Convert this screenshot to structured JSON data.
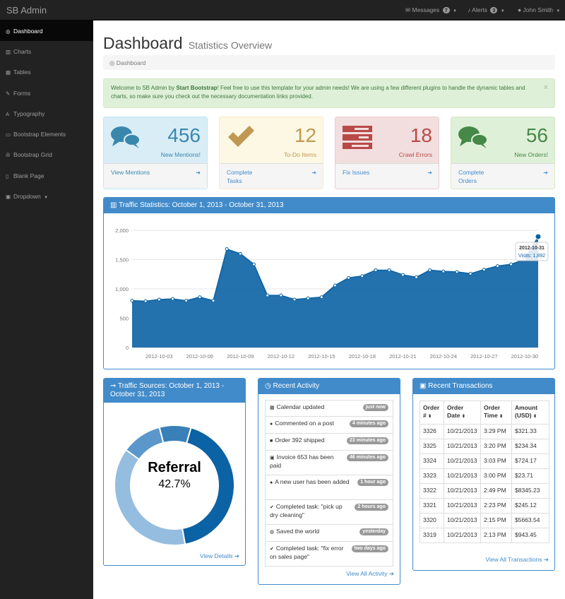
{
  "topnav": {
    "brand": "SB Admin",
    "messages": {
      "label": "Messages",
      "count": "7"
    },
    "alerts": {
      "label": "Alerts",
      "count": "3"
    },
    "user": "John Smith"
  },
  "sidebar": {
    "items": [
      {
        "label": "Dashboard",
        "icon": "dashboard-icon",
        "glyph": "◎"
      },
      {
        "label": "Charts",
        "icon": "bar-chart-icon",
        "glyph": "▥"
      },
      {
        "label": "Tables",
        "icon": "table-icon",
        "glyph": "▦"
      },
      {
        "label": "Forms",
        "icon": "edit-icon",
        "glyph": "✎"
      },
      {
        "label": "Typography",
        "icon": "font-icon",
        "glyph": "A"
      },
      {
        "label": "Bootstrap Elements",
        "icon": "desktop-icon",
        "glyph": "▭"
      },
      {
        "label": "Bootstrap Grid",
        "icon": "wrench-icon",
        "glyph": "✇"
      },
      {
        "label": "Blank Page",
        "icon": "file-icon",
        "glyph": "▯"
      },
      {
        "label": "Dropdown",
        "icon": "caret-square-icon",
        "glyph": "▣"
      }
    ]
  },
  "page": {
    "title": "Dashboard",
    "subtitle": "Statistics Overview",
    "breadcrumb": "Dashboard"
  },
  "alert": {
    "pre": "Welcome to SB Admin by ",
    "strong": "Start Bootstrap",
    "post": "! Feel free to use this template for your admin needs! We are using a few different plugins to handle the dynamic tables and charts, so make sure you check out the necessary documentation links provided.",
    "close": "×"
  },
  "stats": [
    {
      "value": "456",
      "label": "New Mentions!",
      "link": "View Mentions",
      "icon": "comments-icon",
      "color": "#3a87ad"
    },
    {
      "value": "12",
      "label": "To-Do Items",
      "link": "Complete Tasks",
      "icon": "check-icon",
      "color": "#c09853"
    },
    {
      "value": "18",
      "label": "Crawl Errors",
      "link": "Fix Issues",
      "icon": "tasks-icon",
      "color": "#b94a48"
    },
    {
      "value": "56",
      "label": "New Orders!",
      "link": "Complete Orders",
      "icon": "comments-icon",
      "color": "#468847"
    }
  ],
  "traffic": {
    "title": "Traffic Statistics: October 1, 2013 - October 31, 2013",
    "tooltip": {
      "date": "2012-10-31",
      "value": "Visits: 1,892"
    }
  },
  "chart_data": {
    "type": "area",
    "x": [
      "2012-10-01",
      "2012-10-02",
      "2012-10-03",
      "2012-10-04",
      "2012-10-05",
      "2012-10-06",
      "2012-10-07",
      "2012-10-08",
      "2012-10-09",
      "2012-10-10",
      "2012-10-11",
      "2012-10-12",
      "2012-10-13",
      "2012-10-14",
      "2012-10-15",
      "2012-10-16",
      "2012-10-17",
      "2012-10-18",
      "2012-10-19",
      "2012-10-20",
      "2012-10-21",
      "2012-10-22",
      "2012-10-23",
      "2012-10-24",
      "2012-10-25",
      "2012-10-26",
      "2012-10-27",
      "2012-10-28",
      "2012-10-29",
      "2012-10-30",
      "2012-10-31"
    ],
    "values": [
      800,
      790,
      820,
      830,
      800,
      860,
      800,
      1680,
      1600,
      1420,
      890,
      890,
      820,
      840,
      860,
      1060,
      1190,
      1220,
      1320,
      1320,
      1240,
      1200,
      1320,
      1300,
      1290,
      1260,
      1330,
      1390,
      1420,
      1500,
      1892
    ],
    "xticks": [
      "2012-10-03",
      "2012-10-06",
      "2012-10-09",
      "2012-10-12",
      "2012-10-15",
      "2012-10-18",
      "2012-10-21",
      "2012-10-24",
      "2012-10-27",
      "2012-10-30"
    ],
    "yticks": [
      "0",
      "500",
      "1,000",
      "1,500",
      "2,000"
    ],
    "ylim": [
      0,
      2000
    ],
    "grid": true,
    "color": "#0b62a4"
  },
  "sources": {
    "title": "Traffic Sources: October 1, 2013 - October 31, 2013",
    "center_label": "Referral",
    "center_value": "42.7%",
    "link": "View Details",
    "chart_data": {
      "type": "pie",
      "slices": [
        {
          "label": "Referral",
          "value": 42.7,
          "color": "#0b62a4"
        },
        {
          "label": "",
          "value": 37.9,
          "color": "#94bde0"
        },
        {
          "label": "",
          "value": 10.9,
          "color": "#5b97cb"
        },
        {
          "label": "",
          "value": 8.5,
          "color": "#3980b8"
        }
      ]
    }
  },
  "activity": {
    "title": "Recent Activity",
    "items": [
      {
        "text": "Calendar updated",
        "time": "just now",
        "icon": "calendar-icon",
        "glyph": "▦"
      },
      {
        "text": "Commented on a post",
        "time": "4 minutes ago",
        "icon": "comment-icon",
        "glyph": "●"
      },
      {
        "text": "Order 392 shipped",
        "time": "23 minutes ago",
        "icon": "truck-icon",
        "glyph": "■"
      },
      {
        "text": "Invoice 653 has been paid",
        "time": "46 minutes ago",
        "icon": "money-icon",
        "glyph": "▣"
      },
      {
        "text": "A new user has been added",
        "time": "1 hour ago",
        "icon": "user-icon",
        "glyph": "●"
      },
      {
        "text": "Completed task: \"pick up dry cleaning\"",
        "time": "2 hours ago",
        "icon": "check-icon",
        "glyph": "✔"
      },
      {
        "text": "Saved the world",
        "time": "yesterday",
        "icon": "globe-icon",
        "glyph": "◍"
      },
      {
        "text": "Completed task: \"fix error on sales page\"",
        "time": "two days ago",
        "icon": "check-icon",
        "glyph": "✔"
      }
    ],
    "link": "View All Activity"
  },
  "transactions": {
    "title": "Recent Transactions",
    "headers": [
      "Order #",
      "Order Date",
      "Order Time",
      "Amount (USD)"
    ],
    "rows": [
      [
        "3326",
        "10/21/2013",
        "3:29 PM",
        "$321.33"
      ],
      [
        "3325",
        "10/21/2013",
        "3:20 PM",
        "$234.34"
      ],
      [
        "3324",
        "10/21/2013",
        "3:03 PM",
        "$724.17"
      ],
      [
        "3323",
        "10/21/2013",
        "3:00 PM",
        "$23.71"
      ],
      [
        "3322",
        "10/21/2013",
        "2:49 PM",
        "$8345.23"
      ],
      [
        "3321",
        "10/21/2013",
        "2:23 PM",
        "$245.12"
      ],
      [
        "3320",
        "10/21/2013",
        "2:15 PM",
        "$5663.54"
      ],
      [
        "3319",
        "10/21/2013",
        "2:13 PM",
        "$943.45"
      ]
    ],
    "link": "View All Transactions"
  }
}
